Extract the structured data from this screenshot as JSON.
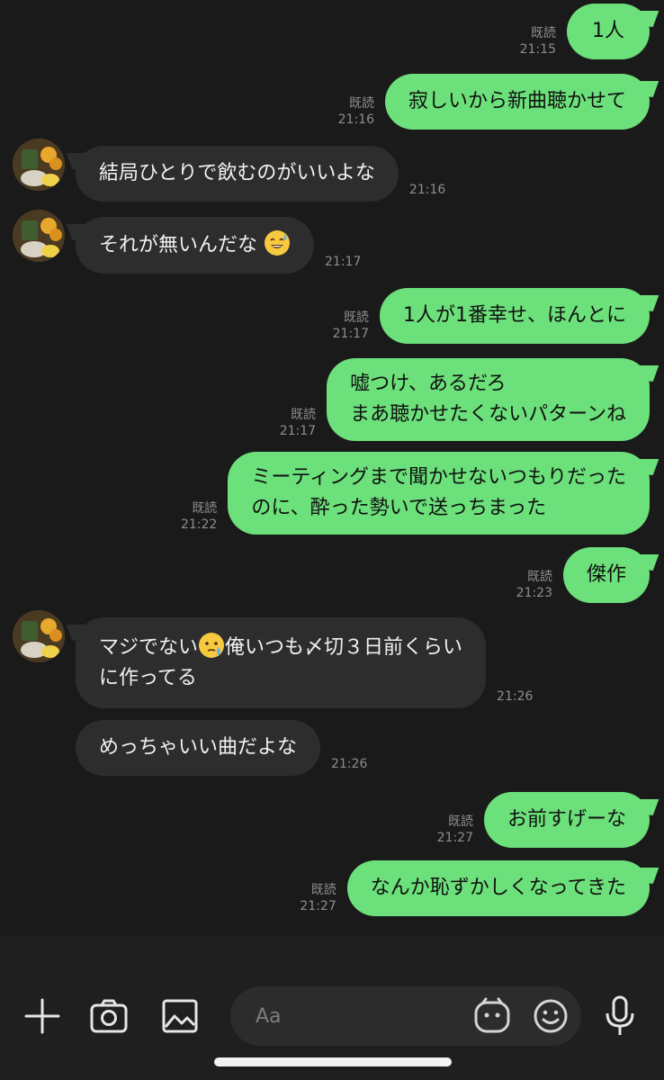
{
  "messages": [
    {
      "dir": "out",
      "read": "既読",
      "time": "21:15",
      "lines": [
        "1人"
      ]
    },
    {
      "dir": "out",
      "read": "既読",
      "time": "21:16",
      "lines": [
        "寂しいから新曲聴かせて"
      ]
    },
    {
      "dir": "in",
      "time": "21:16",
      "lines": [
        "結局ひとりで飲むのがいいよな"
      ]
    },
    {
      "dir": "in",
      "time": "21:17",
      "lines": [
        "それが無いんだな"
      ],
      "emoji": "sweat-smile"
    },
    {
      "dir": "out",
      "read": "既読",
      "time": "21:17",
      "lines": [
        "1人が1番幸せ、ほんとに"
      ]
    },
    {
      "dir": "out",
      "read": "既読",
      "time": "21:17",
      "lines": [
        "嘘つけ、あるだろ",
        "まあ聴かせたくないパターンね"
      ]
    },
    {
      "dir": "out",
      "read": "既読",
      "time": "21:22",
      "lines": [
        "ミーティングまで聞かせないつもりだった",
        "のに、酔った勢いで送っちまった"
      ]
    },
    {
      "dir": "out",
      "read": "既読",
      "time": "21:23",
      "lines": [
        "傑作"
      ]
    },
    {
      "dir": "in",
      "time": "21:26",
      "lines": [
        "マジでない",
        "俺いつも〆切３日前くらい",
        "に作ってる"
      ],
      "emoji": "sweat-face"
    },
    {
      "dir": "in",
      "time": "21:26",
      "lines": [
        "めっちゃいい曲だよな"
      ]
    },
    {
      "dir": "out",
      "read": "既読",
      "time": "21:27",
      "lines": [
        "お前すげーな"
      ]
    },
    {
      "dir": "out",
      "read": "既読",
      "time": "21:27",
      "lines": [
        "なんか恥ずかしくなってきた"
      ]
    }
  ],
  "composer": {
    "placeholder": "Aa"
  },
  "toolbar": [
    "plus-icon",
    "camera-icon",
    "image-icon",
    "sticker-icon",
    "emoji-icon",
    "mic-icon"
  ],
  "colors": {
    "background": "#1a1a1a",
    "outgoing": "#6ce07a",
    "incoming": "#2d2d2d",
    "meta": "#8e8e8e"
  }
}
